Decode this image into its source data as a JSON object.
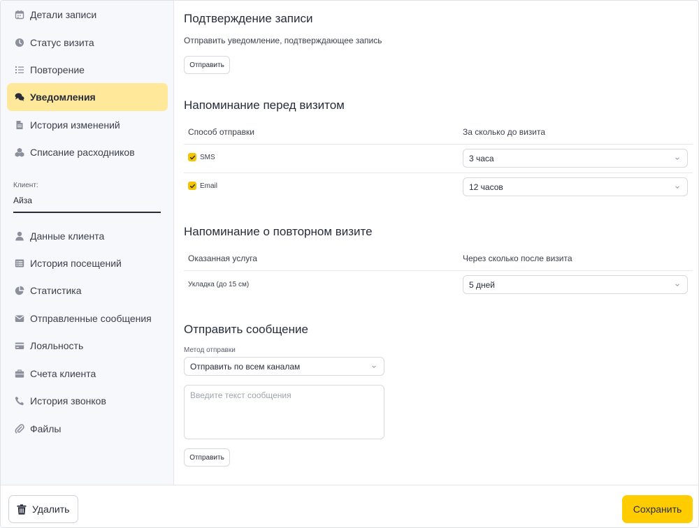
{
  "sidebar": {
    "items": [
      {
        "label": "Детали записи",
        "icon": "calendar-icon"
      },
      {
        "label": "Статус визита",
        "icon": "clock-icon"
      },
      {
        "label": "Повторение",
        "icon": "list-icon"
      },
      {
        "label": "Уведомления",
        "icon": "chat-bubbles-icon",
        "active": true
      },
      {
        "label": "История изменений",
        "icon": "document-icon"
      },
      {
        "label": "Списание расходников",
        "icon": "cubes-icon"
      }
    ],
    "client_label": "Клиент:",
    "client_name": "Айза",
    "client_items": [
      {
        "label": "Данные клиента",
        "icon": "user-icon"
      },
      {
        "label": "История посещений",
        "icon": "list-alt-icon"
      },
      {
        "label": "Статистика",
        "icon": "pie-chart-icon"
      },
      {
        "label": "Отправленные сообщения",
        "icon": "envelope-icon"
      },
      {
        "label": "Лояльность",
        "icon": "credit-card-icon"
      },
      {
        "label": "Счета клиента",
        "icon": "briefcase-icon"
      },
      {
        "label": "История звонков",
        "icon": "phone-icon"
      },
      {
        "label": "Файлы",
        "icon": "paperclip-icon"
      }
    ]
  },
  "confirmation": {
    "title": "Подтверждение записи",
    "description": "Отправить уведомление, подтверждающее запись",
    "send_label": "Отправить"
  },
  "reminder": {
    "title": "Напоминание перед визитом",
    "col_method": "Способ отправки",
    "col_time": "За сколько до визита",
    "rows": [
      {
        "channel": "SMS",
        "checked": true,
        "time": "3 часа"
      },
      {
        "channel": "Email",
        "checked": true,
        "time": "12 часов"
      }
    ]
  },
  "repeat": {
    "title": "Напоминание о повторном визите",
    "col_service": "Оказанная услуга",
    "col_after": "Через сколько после визита",
    "service": "Укладка (до 15 см)",
    "after": "5 дней"
  },
  "message": {
    "title": "Отправить сообщение",
    "method_label": "Метод отправки",
    "method_value": "Отправить по всем каналам",
    "placeholder": "Введите текст сообщения",
    "send_label": "Отправить"
  },
  "footer": {
    "delete_label": "Удалить",
    "save_label": "Сохранить"
  },
  "colors": {
    "accent": "#ffcc00",
    "active_nav": "#ffe89a"
  }
}
